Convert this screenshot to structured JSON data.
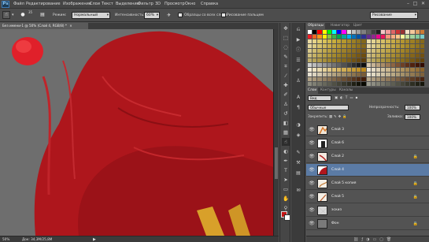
{
  "app": {
    "logo": "Ps"
  },
  "menu": [
    "Файл",
    "Редактирование",
    "Изображение",
    "Слои",
    "Текст",
    "Выделение",
    "Фильтр",
    "3D",
    "Просмотр",
    "Окно",
    "Справка"
  ],
  "window_controls": [
    "–",
    "□",
    "✕"
  ],
  "options": {
    "tool_size": "35",
    "mode_label": "Режим:",
    "mode_value": "Нормальный",
    "intensity_label": "Интенсивность:",
    "intensity_value": "60%",
    "sample_all_label": "Образцы со всех слоев",
    "finger_label": "Рисование пальцем",
    "workspace_value": "Рисование"
  },
  "document": {
    "tab_title": "Без имени-1 @ 50% (Слой 4, RGB/8) *",
    "tab_close": "×",
    "zoom": "50%",
    "doc_info": "Док: 34,3M/25,8M"
  },
  "panels": {
    "color_tabs": [
      "Образцы",
      "Навигатор",
      "Цвет"
    ],
    "layers_tabs": [
      "Слои",
      "Контуры",
      "Каналы"
    ],
    "kind_label": "Вид",
    "blend_mode": "Обычные",
    "opacity_label": "Непрозрачность:",
    "opacity_value": "100%",
    "lock_label": "Закрепить:",
    "fill_label": "Заливка:",
    "fill_value": "100%"
  },
  "layers": [
    {
      "name": "Слой 3",
      "selected": false,
      "locked": false
    },
    {
      "name": "Слой 6",
      "selected": false,
      "locked": false
    },
    {
      "name": "Слой 2",
      "selected": false,
      "locked": true
    },
    {
      "name": "Слой 4",
      "selected": true,
      "locked": false
    },
    {
      "name": "Слой 5 копия",
      "selected": false,
      "locked": true
    },
    {
      "name": "Слой 5",
      "selected": false,
      "locked": true
    },
    {
      "name": "эскиз",
      "selected": false,
      "locked": false
    },
    {
      "name": "Фон",
      "selected": false,
      "locked": true
    }
  ],
  "colors": {
    "foreground": "#c31616",
    "background": "#ffffff",
    "selection": "#5b7ba5",
    "rooster_red": "#b0161d",
    "canvas_gray": "#6d6d6d"
  }
}
